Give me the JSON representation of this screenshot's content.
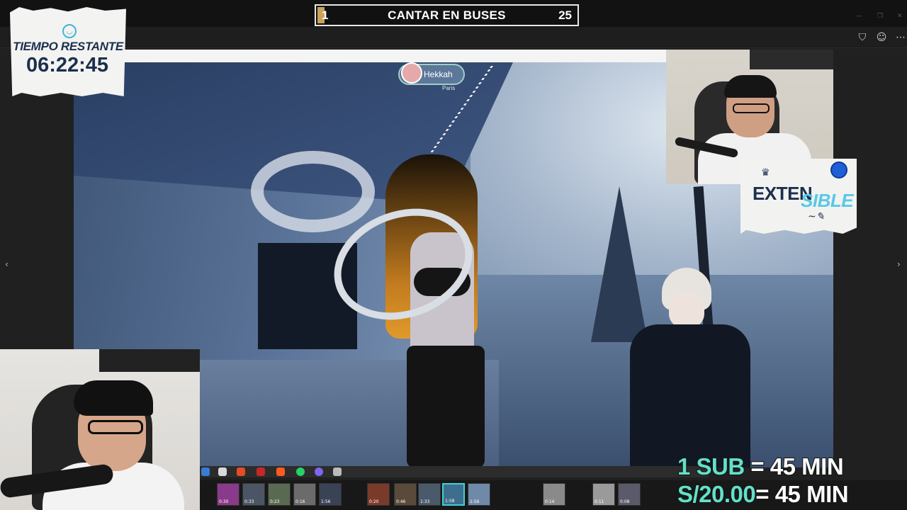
{
  "banner": {
    "left_value": "1",
    "title": "CANTAR EN BUSES",
    "right_value": "25"
  },
  "timer": {
    "label": "TIEMPO RESTANTE",
    "value": "06:22:45"
  },
  "sponsor": {
    "line1": "EXTEN",
    "line2": "SIBLE"
  },
  "nametag": {
    "name": "Hekkah",
    "sub": "Paris"
  },
  "promo": {
    "line1_accent": "1 SUB",
    "line1_rest": " = 45 MIN",
    "line2_accent": "S/20.00",
    "line2_rest": "= 45 MIN"
  },
  "toolbar": {
    "icons": [
      "bookmark-icon",
      "emoji-icon",
      "more-icon"
    ]
  },
  "filmstrip": {
    "thumbs": [
      "0:30",
      "0:33",
      "0:23",
      "0:16",
      "1:56",
      "0:20",
      "0:46",
      "1:33",
      "1:58",
      "1:56",
      "0:14",
      "0:11",
      "0:08"
    ]
  },
  "colors": {
    "accent_teal": "#63e0c8",
    "navy": "#1b2f4e",
    "banner_gold": "#c9a35a"
  }
}
